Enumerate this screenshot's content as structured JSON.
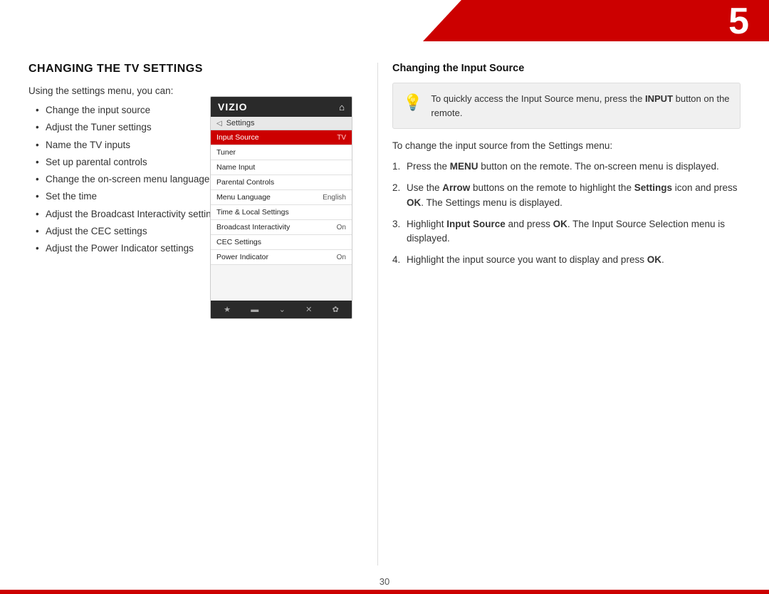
{
  "page": {
    "number": "5",
    "page_footer": "30"
  },
  "header": {
    "section_title": "CHANGING THE TV SETTINGS"
  },
  "left": {
    "intro": "Using the settings menu, you can:",
    "bullets": [
      "Change the input source",
      "Adjust the Tuner settings",
      "Name the TV inputs",
      "Set up parental controls",
      "Change the on-screen menu language",
      "Set the time",
      "Adjust the Broadcast Interactivity setting",
      "Adjust the CEC settings",
      "Adjust the Power Indicator settings"
    ],
    "tv_menu": {
      "brand": "VIZIO",
      "back_label": "Settings",
      "items": [
        {
          "label": "Input Source",
          "value": "TV",
          "highlighted": true
        },
        {
          "label": "Tuner",
          "value": ""
        },
        {
          "label": "Name Input",
          "value": ""
        },
        {
          "label": "Parental Controls",
          "value": ""
        },
        {
          "label": "Menu Language",
          "value": "English"
        },
        {
          "label": "Time & Local Settings",
          "value": ""
        },
        {
          "label": "Broadcast Interactivity",
          "value": "On"
        },
        {
          "label": "CEC Settings",
          "value": ""
        },
        {
          "label": "Power Indicator",
          "value": "On"
        }
      ]
    }
  },
  "right": {
    "section_title": "Changing the Input Source",
    "tip": {
      "text_before": "To quickly access the Input Source menu, press the ",
      "bold_word": "INPUT",
      "text_after": " button on the remote."
    },
    "steps_intro": "To change the input source from the Settings menu:",
    "steps": [
      {
        "num": "1.",
        "text_before": "Press the ",
        "bold": "MENU",
        "text_after": " button on the remote. The on-screen menu is displayed."
      },
      {
        "num": "2.",
        "text_before": "Use the ",
        "bold": "Arrow",
        "text_after": " buttons on the remote to highlight the ",
        "bold2": "Settings",
        "text_after2": " icon and press ",
        "bold3": "OK",
        "text_after3": ". The Settings menu is displayed."
      },
      {
        "num": "3.",
        "text_before": "Highlight ",
        "bold": "Input Source",
        "text_middle": " and press ",
        "bold2": "OK",
        "text_after": ". The Input Source Selection menu is displayed."
      },
      {
        "num": "4.",
        "text_before": "Highlight the input source you want to display and press ",
        "bold": "OK",
        "text_after": "."
      }
    ]
  }
}
